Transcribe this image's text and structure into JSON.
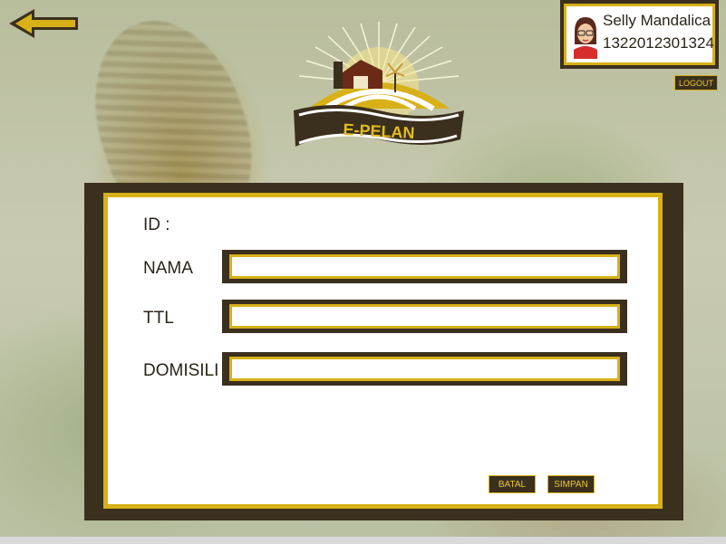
{
  "colors": {
    "dark_brown": "#3b2f1e",
    "gold": "#d7b117",
    "label_text": "#2b2418"
  },
  "header": {
    "back_icon": "left-arrow-icon",
    "logo_text": "E-PELAN"
  },
  "user": {
    "name": "Selly Mandalica",
    "id": "1322012301324",
    "avatar_icon": "user-avatar-icon",
    "logout_label": "LOGOUT"
  },
  "form": {
    "id_label": "ID :",
    "fields": [
      {
        "label": "NAMA",
        "value": ""
      },
      {
        "label": "TTL",
        "value": ""
      },
      {
        "label": "DOMISILI",
        "value": ""
      }
    ],
    "cancel_label": "BATAL",
    "save_label": "SIMPAN"
  }
}
